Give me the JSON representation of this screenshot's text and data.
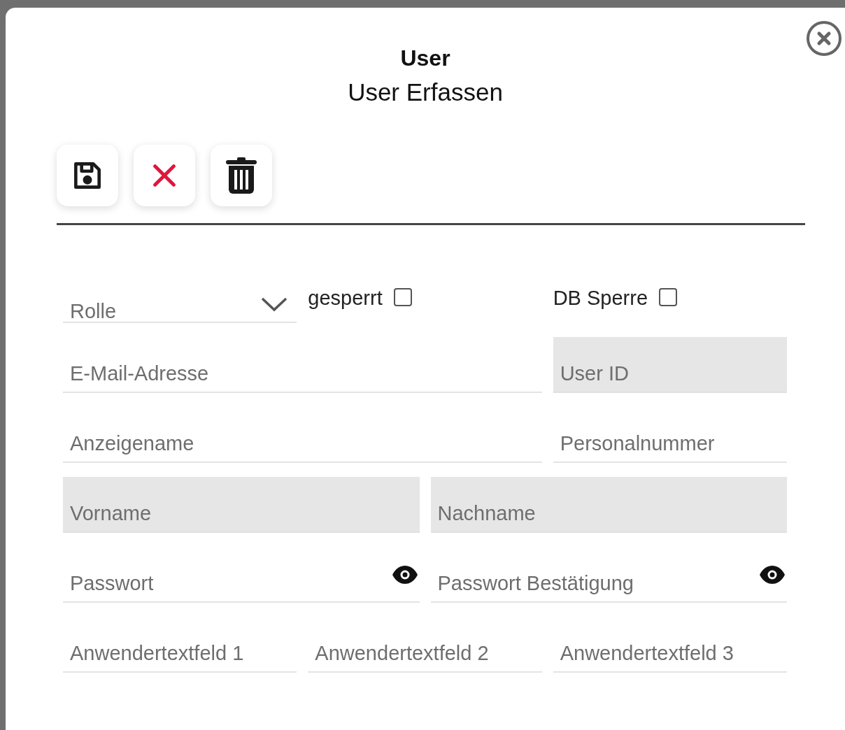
{
  "dialog": {
    "title": "User",
    "subtitle": "User Erfassen"
  },
  "toolbar": [
    {
      "kind": "save"
    },
    {
      "kind": "cancel"
    },
    {
      "kind": "delete"
    }
  ],
  "rows": [
    [
      {
        "kind": "select",
        "placeholder": "Rolle",
        "disabled": false
      },
      {
        "kind": "checkbox",
        "label": "gesperrt",
        "checked": false
      },
      {
        "kind": "checkbox",
        "label": "DB Sperre",
        "checked": false
      }
    ],
    [
      {
        "kind": "text",
        "placeholder": "E-Mail-Adresse",
        "disabled": false
      },
      {
        "kind": "text",
        "placeholder": "User ID",
        "disabled": true
      }
    ],
    [
      {
        "kind": "text",
        "placeholder": "Anzeigename",
        "disabled": false
      },
      {
        "kind": "text",
        "placeholder": "Personalnummer",
        "disabled": false
      }
    ],
    [
      {
        "kind": "text",
        "placeholder": "Vorname",
        "disabled": true
      },
      {
        "kind": "text",
        "placeholder": "Nachname",
        "disabled": true
      }
    ],
    [
      {
        "kind": "password",
        "placeholder": "Passwort",
        "disabled": false
      },
      {
        "kind": "password",
        "placeholder": "Passwort Bestätigung",
        "disabled": false
      }
    ],
    [
      {
        "kind": "text",
        "placeholder": "Anwendertextfeld 1",
        "disabled": false
      },
      {
        "kind": "text",
        "placeholder": "Anwendertextfeld 2",
        "disabled": false
      },
      {
        "kind": "text",
        "placeholder": "Anwendertextfeld 3",
        "disabled": false
      }
    ]
  ]
}
